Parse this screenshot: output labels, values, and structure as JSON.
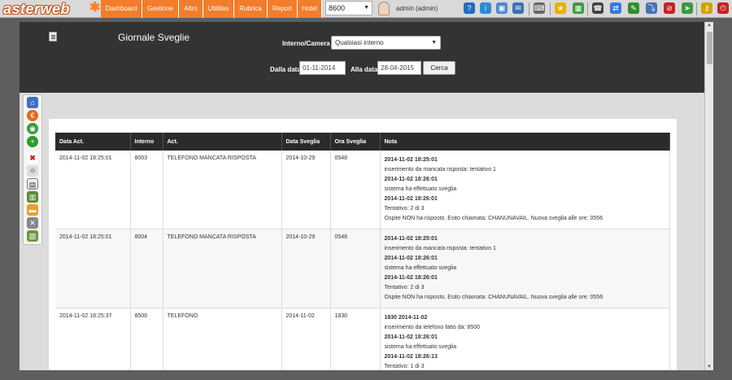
{
  "topbar": {
    "logo": "asterweb",
    "nav": [
      "Dashboard",
      "Gestione",
      "Altro",
      "Utilities",
      "Rubrica",
      "Report",
      "Hotel"
    ],
    "selected_extension": "8600",
    "user_label": "admin (admin)",
    "icons": [
      "help-icon",
      "info-icon",
      "monitor-icon",
      "mail-icon",
      "keyboard-icon",
      "star-icon",
      "calendar-icon",
      "phone-icon",
      "transfer-icon",
      "bug-icon",
      "stop-icon",
      "arrow-icon",
      "key-icon",
      "exit-icon"
    ]
  },
  "header": {
    "title": "Giornale Sveglie",
    "interno_label": "Interno/Camera",
    "interno_value": "Qualsiasi interno",
    "dalla_label": "Dalla data",
    "dalla_value": "01-11-2014",
    "alla_label": "Alla data",
    "alla_value": "28-04-2015",
    "cerca": "Cerca"
  },
  "table": {
    "columns": [
      "Data Act.",
      "Interno",
      "Act.",
      "Data Sveglia",
      "Ora Sveglia",
      "Nota"
    ],
    "rows": [
      {
        "data_act": "2014-11-02 18:25:01",
        "interno": "8003",
        "act": "TELEFONO MANCATA RISPOSTA",
        "data_sveglia": "2014-10-29",
        "ora_sveglia": "0548",
        "nota": [
          {
            "t": "2014-11-02 18:25:01",
            "b": true
          },
          {
            "t": "inserimento da mancata risposta: tentativo 1",
            "b": false
          },
          {
            "t": "2014-11-02 18:26:01",
            "b": true
          },
          {
            "t": "sistema ha effettuato sveglia",
            "b": false
          },
          {
            "t": "2014-11-02 18:26:01",
            "b": true
          },
          {
            "t": "Tentativo: 2 di 3",
            "b": false
          },
          {
            "t": "Ospite NON ha risposto. Esito chiamata: CHANUNAVAIL. Nuova sveglia alle ore: 0556",
            "b": false
          }
        ]
      },
      {
        "data_act": "2014-11-02 18:25:01",
        "interno": "8004",
        "act": "TELEFONO MANCATA RISPOSTA",
        "data_sveglia": "2014-10-29",
        "ora_sveglia": "0548",
        "nota": [
          {
            "t": "2014-11-02 18:25:01",
            "b": true
          },
          {
            "t": "inserimento da mancata risposta: tentativo 1",
            "b": false
          },
          {
            "t": "2014-11-02 18:26:01",
            "b": true
          },
          {
            "t": "sistema ha effettuato sveglia",
            "b": false
          },
          {
            "t": "2014-11-02 18:26:01",
            "b": true
          },
          {
            "t": "Tentativo: 2 di 3",
            "b": false
          },
          {
            "t": "Ospite NON ha risposto. Esito chiamata: CHANUNAVAIL. Nuova sveglia alle ore: 0556",
            "b": false
          }
        ]
      },
      {
        "data_act": "2014-11-02 18:25:37",
        "interno": "8500",
        "act": "TELEFONO",
        "data_sveglia": "2014-11-02",
        "ora_sveglia": "1830",
        "nota": [
          {
            "t": "1830 2014-11-02",
            "b": true
          },
          {
            "t": "inserimento da telefono fatto da: 8500",
            "b": false
          },
          {
            "t": "2014-11-02 18:26:01",
            "b": true
          },
          {
            "t": "sistema ha effettuato sveglia",
            "b": false
          },
          {
            "t": "2014-11-02 18:26:13",
            "b": true
          },
          {
            "t": "Tentativo: 1 di 3",
            "b": false
          }
        ]
      }
    ]
  },
  "sidebar_icons": [
    "home-icon",
    "euro-icon",
    "globe-icon",
    "add-icon",
    "delete-icon",
    "settings-icon",
    "document-icon",
    "building-icon",
    "bed-icon",
    "tools-icon",
    "report-icon"
  ]
}
